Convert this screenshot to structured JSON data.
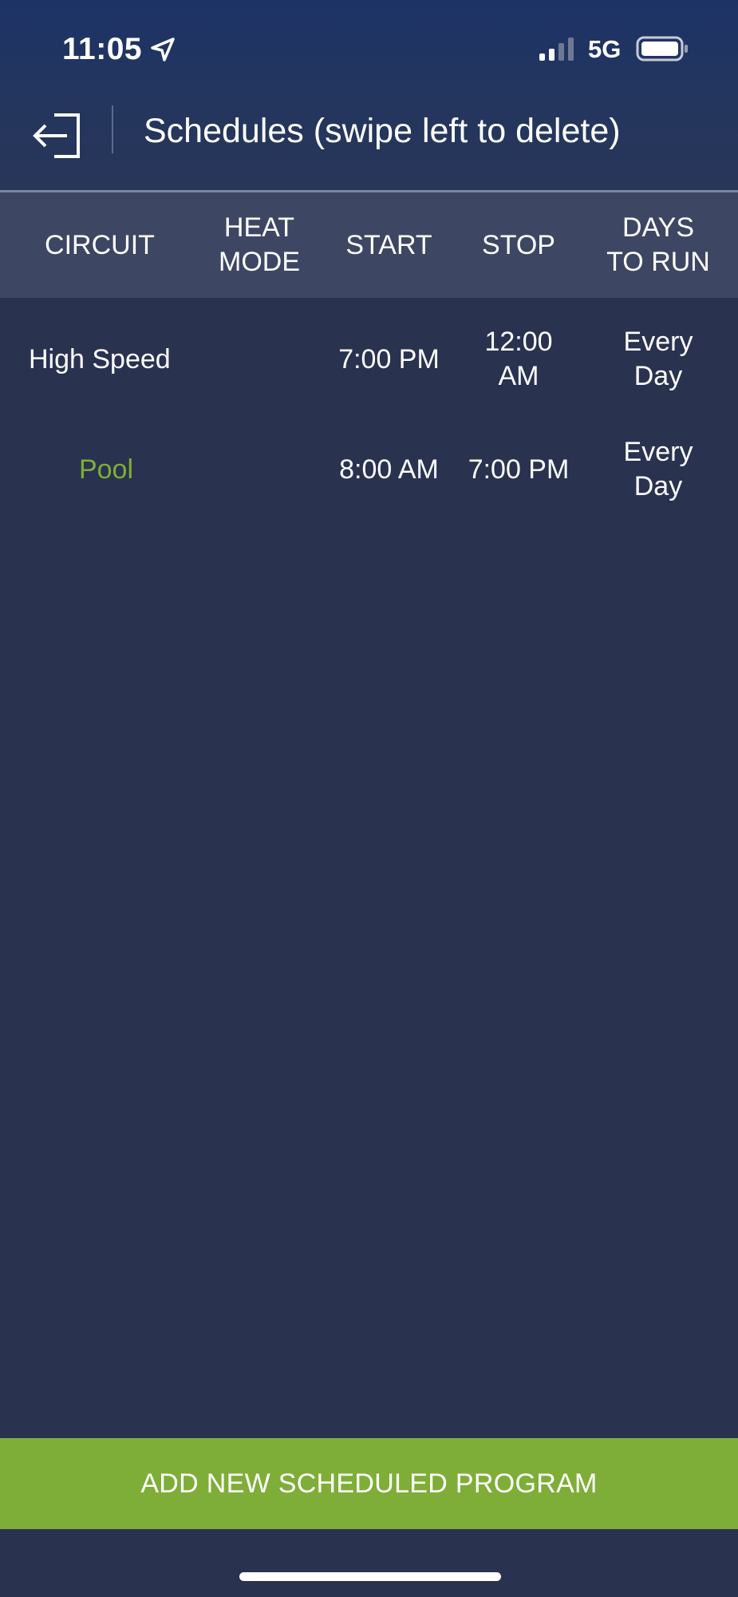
{
  "status_bar": {
    "time": "11:05",
    "location_icon": "location-arrow-icon",
    "signal_icon": "cellular-signal-icon",
    "network": "5G",
    "battery_icon": "battery-icon"
  },
  "nav": {
    "back_icon": "exit-arrow-icon",
    "title": "Schedules (swipe left to delete)"
  },
  "table": {
    "headers": [
      {
        "line1": "CIRCUIT",
        "line2": ""
      },
      {
        "line1": "HEAT",
        "line2": "MODE"
      },
      {
        "line1": "START",
        "line2": ""
      },
      {
        "line1": "STOP",
        "line2": ""
      },
      {
        "line1": "DAYS",
        "line2": "TO RUN"
      }
    ],
    "rows": [
      {
        "circuit": "High Speed",
        "circuit_color": "#ffffff",
        "heat_mode": "",
        "start": "7:00 PM",
        "stop_line1": "12:00",
        "stop_line2": "AM",
        "days_line1": "Every",
        "days_line2": "Day"
      },
      {
        "circuit": "Pool",
        "circuit_color": "#7eae37",
        "heat_mode": "",
        "start": "8:00 AM",
        "stop_line1": "7:00 PM",
        "stop_line2": "",
        "days_line1": "Every",
        "days_line2": "Day"
      }
    ]
  },
  "footer": {
    "add_button_label": "ADD NEW SCHEDULED PROGRAM"
  },
  "colors": {
    "background": "#29324f",
    "header_band": "#3d4662",
    "accent_green": "#7eae37",
    "nav_top": "#1d3367"
  }
}
